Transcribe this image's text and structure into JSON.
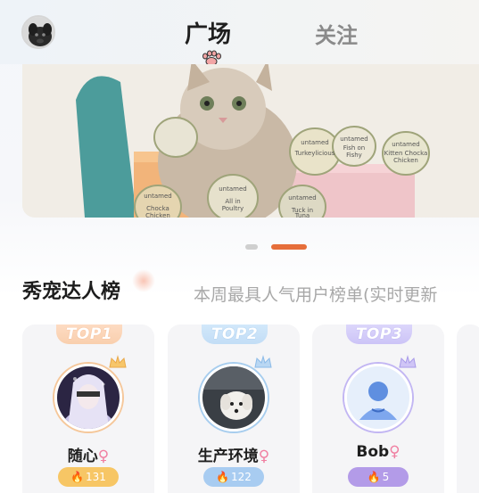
{
  "header": {
    "tabs": [
      {
        "label": "广场",
        "active": true
      },
      {
        "label": "关注",
        "active": false
      }
    ]
  },
  "banner": {
    "can_labels": [
      "Chocka Chicken",
      "All in Poultry",
      "Tuck in Tuna",
      "Turkeylicious",
      "Fish on Fishy",
      "Kitten Chocka Chicken"
    ],
    "brand": "untamed"
  },
  "carousel": {
    "page": 2,
    "total": 2
  },
  "ranking": {
    "title": "秀宠达人榜",
    "subtitle": "本周最具人气用户榜单(实时更新",
    "users": [
      {
        "rank_label": "TOP1",
        "name": "随心",
        "gender": "♀",
        "score": "131"
      },
      {
        "rank_label": "TOP2",
        "name": "生产环境",
        "gender": "♀",
        "score": "122"
      },
      {
        "rank_label": "TOP3",
        "name": "Bob",
        "gender": "♀",
        "score": "5"
      }
    ]
  },
  "colors": {
    "accent": "#e66e3a",
    "gold": "#f7c665",
    "blue": "#a8ccf1",
    "purple": "#b39be8",
    "female": "#f07fa1"
  }
}
